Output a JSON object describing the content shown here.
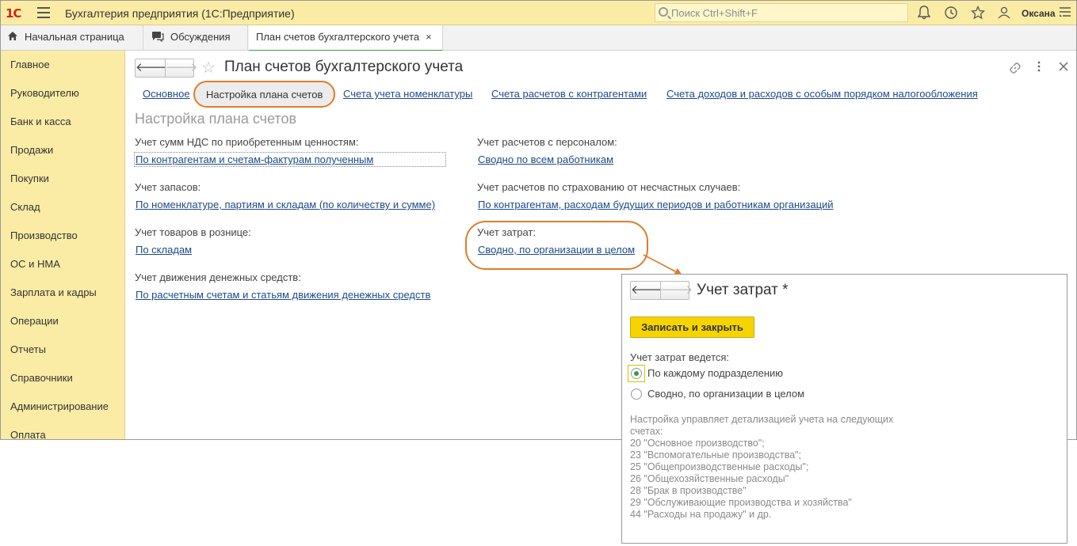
{
  "titlebar": {
    "logo": "1С",
    "title": "Бухгалтерия предприятия  (1С:Предприятие)",
    "search_placeholder": "Поиск Ctrl+Shift+F",
    "user": "Оксана"
  },
  "tabs": [
    {
      "label": "Начальная страница"
    },
    {
      "label": "Обсуждения"
    },
    {
      "label": "План счетов бухгалтерского учета",
      "close": "×"
    }
  ],
  "sidebar": {
    "items": [
      {
        "label": "Главное"
      },
      {
        "label": "Руководителю"
      },
      {
        "label": "Банк и касса"
      },
      {
        "label": "Продажи"
      },
      {
        "label": "Покупки"
      },
      {
        "label": "Склад"
      },
      {
        "label": "Производство"
      },
      {
        "label": "ОС и НМА"
      },
      {
        "label": "Зарплата и кадры"
      },
      {
        "label": "Операции"
      },
      {
        "label": "Отчеты"
      },
      {
        "label": "Справочники"
      },
      {
        "label": "Администрирование"
      },
      {
        "label": "Оплата"
      }
    ]
  },
  "form": {
    "back": "🡐",
    "forward": "🡒",
    "title": "План счетов бухгалтерского учета",
    "links": [
      {
        "label": "Основное"
      },
      {
        "label": "Настройка плана счетов"
      },
      {
        "label": "Счета учета номенклатуры"
      },
      {
        "label": "Счета расчетов с контрагентами"
      },
      {
        "label": "Счета доходов и расходов с особым порядком налогообложения"
      }
    ],
    "section_title": "Настройка плана счетов",
    "left": [
      {
        "label": "Учет сумм НДС по приобретенным ценностям:",
        "value": "По контрагентам и счетам-фактурам полученным"
      },
      {
        "label": "Учет запасов:",
        "value": "По номенклатуре, партиям и складам (по количеству и сумме)"
      },
      {
        "label": "Учет товаров в рознице:",
        "value": "По складам"
      },
      {
        "label": "Учет движения денежных средств:",
        "value": "По расчетным счетам и статьям движения денежных средств"
      }
    ],
    "right": [
      {
        "label": "Учет расчетов с персоналом:",
        "value": "Сводно по всем работникам"
      },
      {
        "label": "Учет расчетов по страхованию от несчастных случаев:",
        "value": "По контрагентам, расходам будущих периодов и работникам организаций"
      },
      {
        "label": "Учет затрат:",
        "value": "Сводно, по организации в целом"
      }
    ]
  },
  "popup": {
    "title": "Учет затрат *",
    "save_button": "Записать и закрыть",
    "group_label": "Учет затрат ведется:",
    "options": [
      {
        "label": "По каждому подразделению",
        "selected": true
      },
      {
        "label": "Сводно, по организации в целом",
        "selected": false
      }
    ],
    "note_lines": [
      "Настройка управляет детализацией учета на следующих",
      "счетах:",
      "20 \"Основное производство\";",
      "23 \"Вспомогательные производства\";",
      "25 \"Общепроизводственные расходы\";",
      "26 \"Общехозяйственные расходы\"",
      "28 \"Брак в производстве\"",
      "29 \"Обслуживающие производства и хозяйства\"",
      "44 \"Расходы на продажу\" и др."
    ]
  },
  "colors": {
    "title_bar": "#fbeca5",
    "sidebar": "#fbeca5",
    "link": "#1d4b8a",
    "highlight": "#e07c2b",
    "save_button": "#f6d400",
    "active_tab_underline": "#3c9a4d"
  }
}
